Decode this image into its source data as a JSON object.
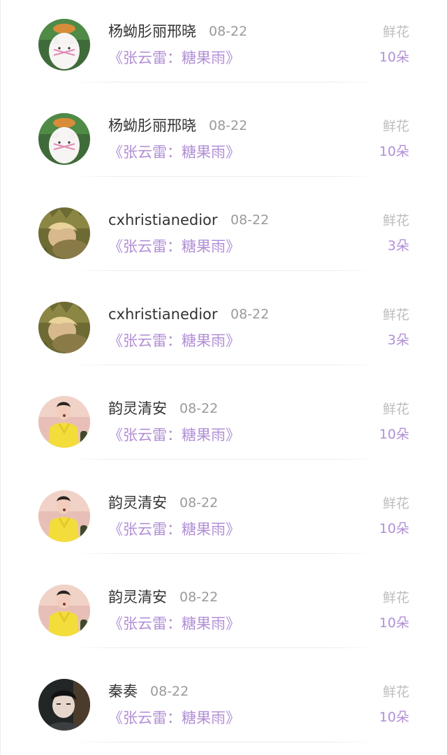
{
  "records": [
    {
      "avatar": "cat-avatar",
      "username": "杨蚴肜丽邢晓",
      "date": "08-22",
      "work": "《张云雷：糖果雨》",
      "gift_type": "鲜花",
      "gift_count": "10朵"
    },
    {
      "avatar": "cat-avatar",
      "username": "杨蚴肜丽邢晓",
      "date": "08-22",
      "work": "《张云雷：糖果雨》",
      "gift_type": "鲜花",
      "gift_count": "10朵"
    },
    {
      "avatar": "grass-portrait-avatar",
      "username": "cxhristianedior",
      "date": "08-22",
      "work": "《张云雷：糖果雨》",
      "gift_type": "鲜花",
      "gift_count": "3朵"
    },
    {
      "avatar": "grass-portrait-avatar",
      "username": "cxhristianedior",
      "date": "08-22",
      "work": "《张云雷：糖果雨》",
      "gift_type": "鲜花",
      "gift_count": "3朵"
    },
    {
      "avatar": "yellow-shirt-avatar",
      "username": "韵灵清安",
      "date": "08-22",
      "work": "《张云雷：糖果雨》",
      "gift_type": "鲜花",
      "gift_count": "10朵"
    },
    {
      "avatar": "yellow-shirt-avatar",
      "username": "韵灵清安",
      "date": "08-22",
      "work": "《张云雷：糖果雨》",
      "gift_type": "鲜花",
      "gift_count": "10朵"
    },
    {
      "avatar": "yellow-shirt-avatar",
      "username": "韵灵清安",
      "date": "08-22",
      "work": "《张云雷：糖果雨》",
      "gift_type": "鲜花",
      "gift_count": "10朵"
    },
    {
      "avatar": "dark-portrait-avatar",
      "username": "秦奏",
      "date": "08-22",
      "work": "《张云雷：糖果雨》",
      "gift_type": "鲜花",
      "gift_count": "10朵"
    }
  ],
  "colors": {
    "accent_purple": "#b28fd6",
    "username_text": "#333333",
    "muted_text": "#9a9a9a",
    "gift_type_text": "#bdbdbd"
  }
}
